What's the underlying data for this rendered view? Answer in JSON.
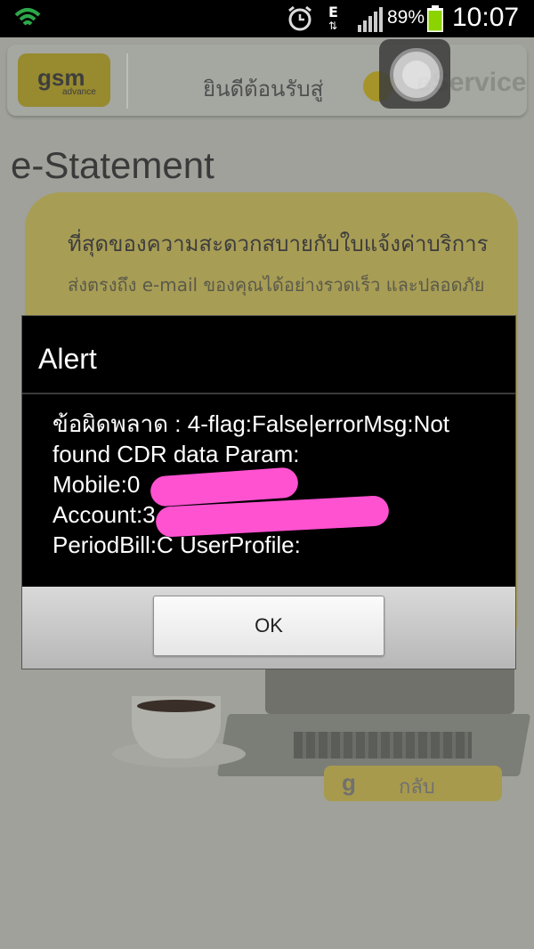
{
  "status_bar": {
    "network_type": "E",
    "battery_percent": "89%",
    "time": "10:07",
    "icons": [
      "wifi-icon",
      "alarm-icon",
      "data-arrows-icon",
      "signal-icon",
      "battery-icon"
    ]
  },
  "app": {
    "logo_text": "gsm",
    "logo_subtext": "advance",
    "welcome_text": "ยินดีต้อนรับสู่",
    "eservice_text": "eService",
    "page_title": "e-Statement",
    "card_text_1": "ที่สุดของความสะดวกสบายกับใบแจ้งค่าบริการ",
    "card_text_2": "ส่งตรงถึง e-mail ของคุณได้อย่างรวดเร็ว และปลอดภัย",
    "back_button": "กลับ"
  },
  "dialog": {
    "title": "Alert",
    "lines": [
      "ข้อผิดพลาด : 4-flag:False|errorMsg:Not",
      "found CDR data Param:",
      "Mobile:0",
      "Account:3",
      "PeriodBill:C UserProfile:"
    ],
    "ok_label": "OK"
  },
  "colors": {
    "redaction": "#ff52d1",
    "battery_fill": "#8bd400",
    "wifi": "#2ca84a"
  }
}
